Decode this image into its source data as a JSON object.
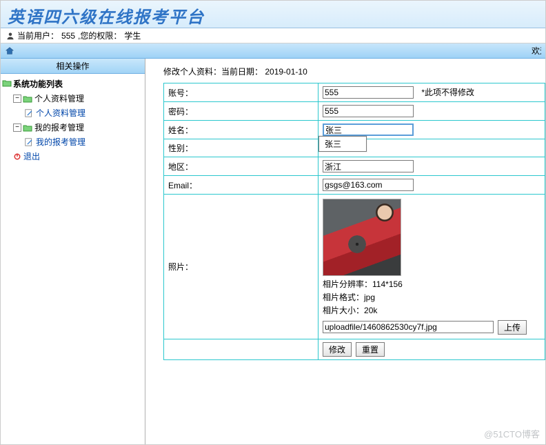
{
  "header": {
    "title": "英语四六级在线报考平台"
  },
  "userbar": {
    "prefix": "当前用户：",
    "name": "555",
    "role_prefix": ",您的权限：",
    "role": "学生"
  },
  "crumb": {
    "welcome_snip": "欢迎"
  },
  "sidebar": {
    "panel_title": "相关操作",
    "root": "系统功能列表",
    "groups": [
      {
        "label": "个人资料管理",
        "children": [
          {
            "label": "个人资料管理"
          }
        ]
      },
      {
        "label": "我的报考管理",
        "children": [
          {
            "label": "我的报考管理"
          }
        ]
      }
    ],
    "exit": "退出"
  },
  "main": {
    "heading_prefix": "修改个人资料：当前日期：",
    "date": "2019-01-10",
    "rows": {
      "account": {
        "label": "账号：",
        "value": "555",
        "note": "*此项不得修改"
      },
      "password": {
        "label": "密码：",
        "value": "555"
      },
      "name": {
        "label": "姓名：",
        "value": "张三",
        "suggest": "张三"
      },
      "gender": {
        "label": "性别："
      },
      "region": {
        "label": "地区：",
        "value": "浙江"
      },
      "email": {
        "label": "Email：",
        "value": "gsgs@163.com"
      },
      "photo": {
        "label": "照片：",
        "res_label": "相片分辨率：",
        "res_value": "114*156",
        "fmt_label": "相片格式：",
        "fmt_value": "jpg",
        "size_label": "相片大小：",
        "size_value": "20k",
        "path": "uploadfile/1460862530cy7f.jpg",
        "upload_btn": "上传"
      }
    },
    "actions": {
      "submit": "修改",
      "reset": "重置"
    }
  },
  "watermark": "@51CTO博客"
}
